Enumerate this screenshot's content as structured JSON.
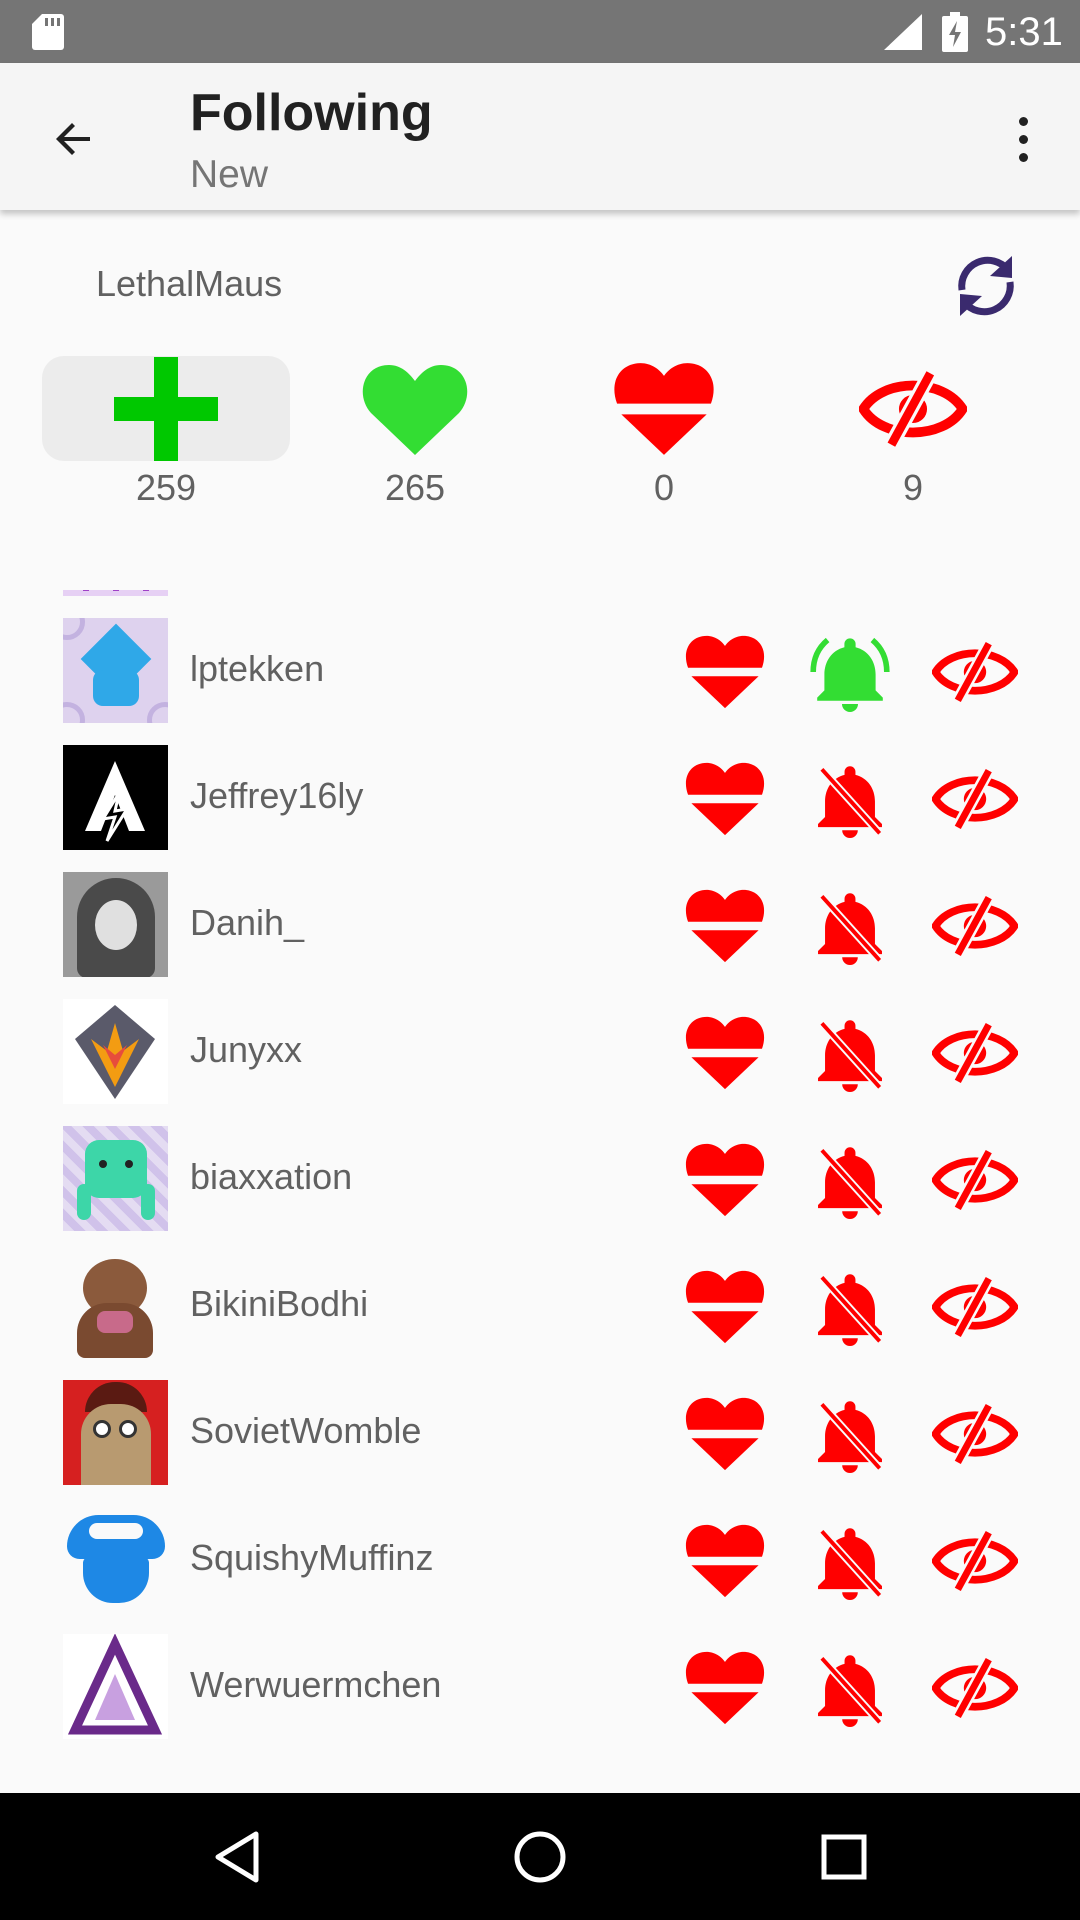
{
  "status_bar": {
    "time": "5:31",
    "icons": [
      "sd-card-icon",
      "cell-signal-icon",
      "battery-charging-icon"
    ]
  },
  "app_bar": {
    "title": "Following",
    "subtitle": "New",
    "back_icon": "arrow-back-icon",
    "menu_icon": "more-vert-icon"
  },
  "header": {
    "username": "LethalMaus",
    "refresh_icon": "refresh-icon"
  },
  "stats": [
    {
      "icon": "plus-icon",
      "count": "259",
      "color": "#00c800",
      "selected": true
    },
    {
      "icon": "heart-icon",
      "count": "265",
      "color": "#33dd33"
    },
    {
      "icon": "heart-split-icon",
      "count": "0",
      "color": "#ff0000"
    },
    {
      "icon": "eye-slash-icon",
      "count": "9",
      "color": "#ff0000"
    }
  ],
  "colors": {
    "red": "#ff0000",
    "green": "#33dd33",
    "text_gray": "#616161",
    "appbar_bg": "#f5f5f5"
  },
  "following": [
    {
      "name": "lptekken",
      "notifications_on": true
    },
    {
      "name": "Jeffrey16ly",
      "notifications_on": false
    },
    {
      "name": "Danih_",
      "notifications_on": false
    },
    {
      "name": "Junyxx",
      "notifications_on": false
    },
    {
      "name": "biaxxation",
      "notifications_on": false
    },
    {
      "name": "BikiniBodhi",
      "notifications_on": false
    },
    {
      "name": "SovietWomble",
      "notifications_on": false
    },
    {
      "name": "SquishyMuffinz",
      "notifications_on": false
    },
    {
      "name": "Werwuermchen",
      "notifications_on": false
    }
  ],
  "nav_bar": {
    "icons": [
      "nav-back-icon",
      "nav-home-icon",
      "nav-recents-icon"
    ]
  }
}
